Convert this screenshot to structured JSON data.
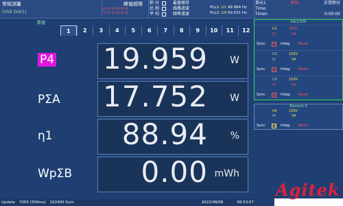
{
  "topbar": {
    "mode": "常规测量",
    "disk": "[USB Disk1]",
    "peak_over": "峰值超限",
    "peak_rows": [
      "01 02 03 04 05 06",
      "11 12 13 14 15 16"
    ],
    "flags": [
      "积 分",
      "比 例",
      "平 均"
    ],
    "options": [
      "最值保持",
      "线路滤波",
      "频率滤波"
    ],
    "pll1": "PLL1:",
    "pll1_ch": "U1",
    "pll1_val": "49.984 Hz",
    "pll2": "PLL2:",
    "pll2_ch": "U4",
    "pll2_val": "50.031 Hz",
    "right_row1": [
      "单元1",
      "积分",
      "正常积分"
    ],
    "right_row2_label": "Time:",
    "right_row2_val": "",
    "right_row3_label": "Timer:",
    "right_row3_val": "0:00:00"
  },
  "numeric": {
    "label": "数值",
    "tabs": [
      "1",
      "2",
      "3",
      "4",
      "5",
      "6",
      "7",
      "8",
      "9",
      "10",
      "11",
      "12"
    ],
    "active_tab": "1",
    "rows": [
      {
        "label": "P4",
        "value": "19.959",
        "unit": "W",
        "highlight": true
      },
      {
        "label": "PΣA",
        "value": "17.752",
        "unit": "W",
        "highlight": false
      },
      {
        "label": "η1",
        "value": "88.94",
        "unit": "%",
        "highlight": false
      },
      {
        "label": "WpΣB",
        "value": "0.00",
        "unit": "mWh",
        "highlight": false
      }
    ]
  },
  "elements": {
    "title": "ΣA(1/3/4)",
    "blocks": [
      {
        "u_label": "U1",
        "u_val": "450V",
        "i_label": "I1",
        "i_val": "5A",
        "sync": "Sync:",
        "sync_ch": "U1",
        "integ": "Integ:",
        "integ_val": "Reset"
      },
      {
        "u_label": "U2",
        "u_val": "150V",
        "i_label": "I2",
        "i_val": "5A",
        "sync": "Sync:",
        "sync_ch": "U2",
        "integ": "Integ:",
        "integ_val": "Reset"
      },
      {
        "u_label": "U3",
        "u_val": "150V",
        "i_label": "I3",
        "i_val": "5A",
        "sync": "Sync:",
        "sync_ch": "U3",
        "integ": "Integ:",
        "integ_val": "Reset"
      }
    ],
    "element4": {
      "title": "Element 4",
      "u_label": "U4",
      "u_val": "150V",
      "i_label": "I4",
      "i_val": "5A",
      "sync": "Sync:",
      "sync_ch": "U4",
      "integ": "Integ:",
      "integ_val": "Reset"
    }
  },
  "status": {
    "update": "Update",
    "count": "7055 (500ms)",
    "mode": "102400 Sum",
    "date": "2022/08/08",
    "time": "08:53:57"
  },
  "logo": "Agitek",
  "colors": {
    "background": "#1f3f73",
    "accent_green": "#39d65f",
    "highlight_magenta": "#e016e0",
    "logo_red": "#e0203a"
  }
}
